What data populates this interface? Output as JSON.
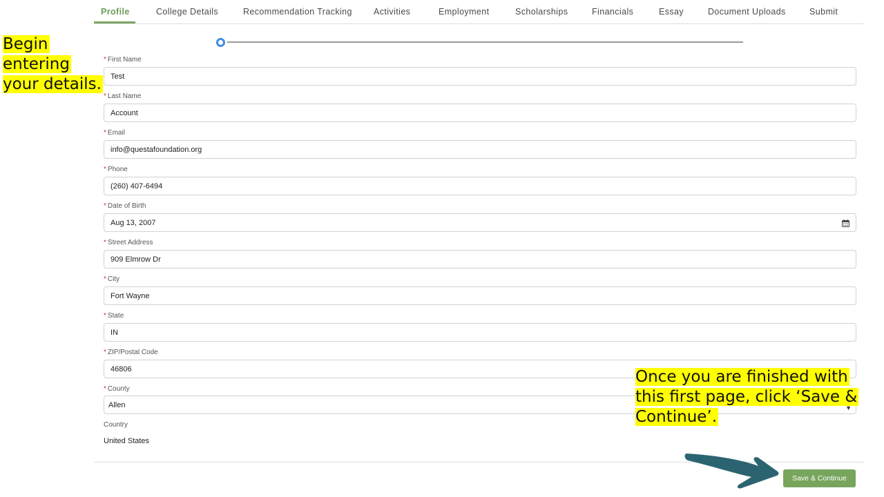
{
  "tabs": [
    {
      "label": "Profile"
    },
    {
      "label": "College Details"
    },
    {
      "label": "Recommendation Tracking"
    },
    {
      "label": "Activities"
    },
    {
      "label": "Employment"
    },
    {
      "label": "Scholarships"
    },
    {
      "label": "Financials"
    },
    {
      "label": "Essay"
    },
    {
      "label": "Document Uploads"
    },
    {
      "label": "Submit"
    }
  ],
  "form": {
    "required_marker": "*",
    "fields": [
      {
        "label": "First Name",
        "value": "Test"
      },
      {
        "label": "Last Name",
        "value": "Account"
      },
      {
        "label": "Email",
        "value": "info@questafoundation.org"
      },
      {
        "label": "Phone",
        "value": "(260) 407-6494"
      },
      {
        "label": "Date of Birth",
        "value": "Aug 13, 2007"
      },
      {
        "label": "Street Address",
        "value": "909 Elmrow Dr"
      },
      {
        "label": "City",
        "value": "Fort Wayne"
      },
      {
        "label": "State",
        "value": "IN"
      },
      {
        "label": "ZIP/Postal Code",
        "value": "46806"
      },
      {
        "label": "County",
        "value": "Allen"
      }
    ],
    "country_label": "Country",
    "country_value": "United States"
  },
  "footer": {
    "save_label": "Save & Continue"
  },
  "annotations": {
    "left_lines": [
      "Begin",
      "entering",
      "your details."
    ],
    "right_lines": [
      "Once you are finished with",
      "this first page, click ‘Save &",
      "Continue’."
    ]
  },
  "colors": {
    "accent_green": "#77a55c",
    "progress_blue": "#3f8ae6",
    "highlight": "#ffff00",
    "arrow": "#2b6470"
  }
}
